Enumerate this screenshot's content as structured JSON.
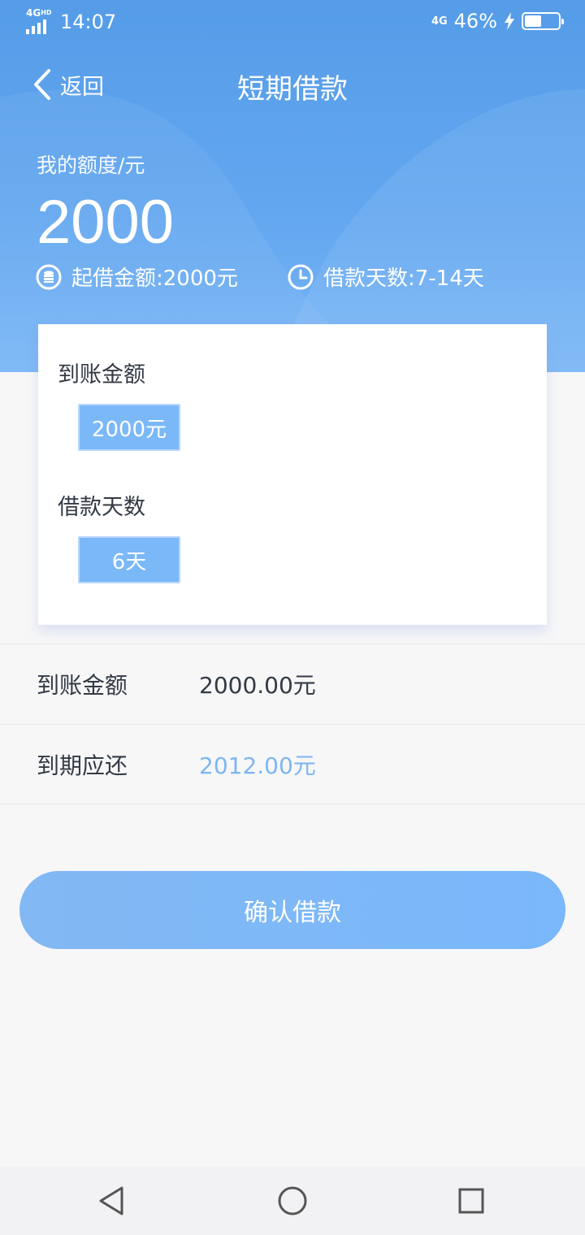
{
  "status": {
    "network": "4G",
    "hd": "HD",
    "time": "14:07",
    "net_right": "4G",
    "battery": "46%"
  },
  "header": {
    "back_label": "返回",
    "title": "短期借款"
  },
  "quota": {
    "label": "我的额度/元",
    "value": "2000",
    "min_amount": "起借金额:2000元",
    "days_range": "借款天数:7-14天"
  },
  "card": {
    "amount_label": "到账金额",
    "amount_option": "2000元",
    "days_label": "借款天数",
    "days_option": "6天"
  },
  "summary": [
    {
      "key": "到账金额",
      "value": "2000.00元"
    },
    {
      "key": "到期应还",
      "value": "2012.00元"
    }
  ],
  "confirm_label": "确认借款",
  "colors": {
    "primary": "#5a9fea",
    "button": "#7ab7fb",
    "accent_text": "#7db6f2"
  },
  "icons": [
    "back-icon",
    "coin-icon",
    "clock-icon",
    "nav-back-triangle-icon",
    "nav-home-circle-icon",
    "nav-recents-square-icon"
  ]
}
